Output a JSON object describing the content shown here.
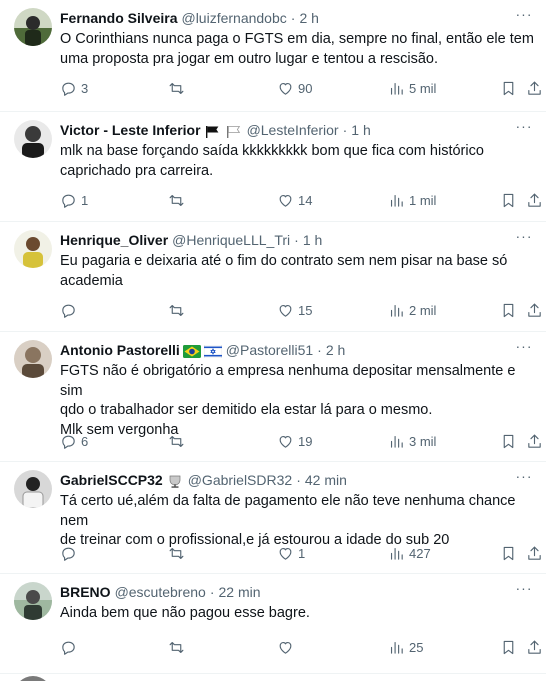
{
  "tweets": [
    {
      "name": "Fernando Silveira",
      "handle": "@luizfernandobc",
      "time": "2 h",
      "lines": [
        "O Corinthians nunca paga o FGTS em dia, sempre no final, então ele tem",
        "uma proposta pra jogar em outro lugar e tentou a rescisão."
      ],
      "replies": "3",
      "retweets": "",
      "likes": "90",
      "views": "5 mil",
      "avatar_color": "#4f6b3a"
    },
    {
      "name": "Victor - Leste Inferior",
      "handle": "@LesteInferior",
      "time": "1 h",
      "lines": [
        "mlk na base forçando saída kkkkkkkkk bom que fica com histórico",
        "caprichado pra carreira."
      ],
      "replies": "1",
      "retweets": "",
      "likes": "14",
      "views": "1 mil",
      "avatar_color": "#3a3a3a"
    },
    {
      "name": "Henrique_Oliver",
      "handle": "@HenriqueLLL_Tri",
      "time": "1 h",
      "lines": [
        "Eu pagaria e deixaria até o fim do contrato sem nem pisar na base só",
        "academia"
      ],
      "replies": "",
      "retweets": "",
      "likes": "15",
      "views": "2 mil",
      "avatar_color": "#d6c23a"
    },
    {
      "name": "Antonio Pastorelli",
      "handle": "@Pastorelli51",
      "time": "2 h",
      "lines": [
        "FGTS não é obrigatório a empresa nenhuma depositar mensalmente e sim",
        "qdo o trabalhador ser demitido ela estar lá para o mesmo.",
        "Mlk sem vergonha"
      ],
      "replies": "6",
      "retweets": "",
      "likes": "19",
      "views": "3 mil",
      "avatar_color": "#8a7560"
    },
    {
      "name": "GabrielSCCP32",
      "handle": "@GabrielSDR32",
      "time": "42 min",
      "lines": [
        "Tá certo ué,além da falta de pagamento ele não teve nenhuma chance nem",
        "de treinar com o profissional,e já estourou a idade do sub 20"
      ],
      "replies": "",
      "retweets": "",
      "likes": "1",
      "views": "427",
      "avatar_color": "#e8e8e8"
    },
    {
      "name": "BRENO",
      "handle": "@escutebreno",
      "time": "22 min",
      "lines": [
        "Ainda bem que não pagou esse bagre."
      ],
      "replies": "",
      "retweets": "",
      "likes": "",
      "views": "25",
      "avatar_color": "#9fb8a0"
    }
  ],
  "separator": "·",
  "more_label": "···"
}
